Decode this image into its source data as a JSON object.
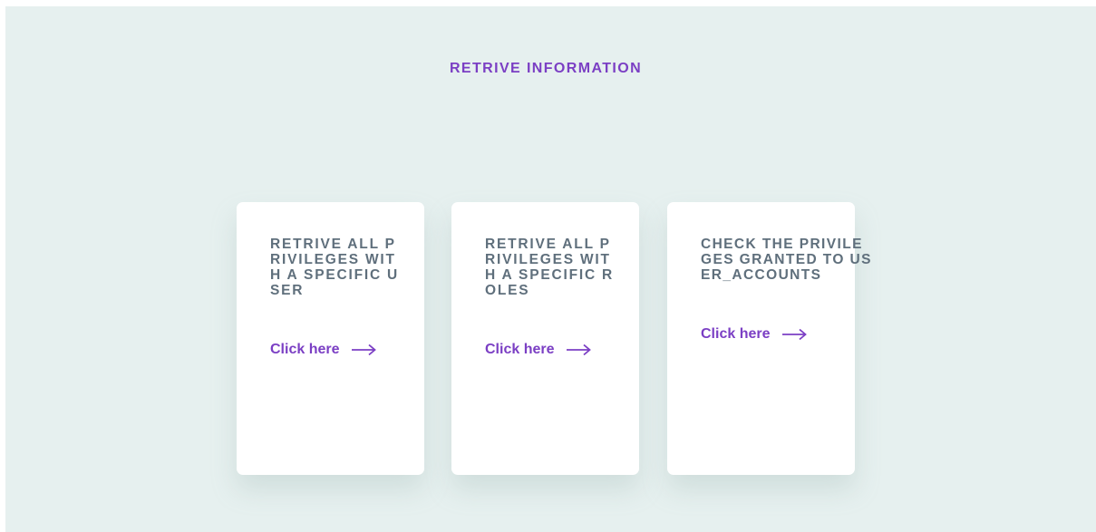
{
  "page": {
    "title": "RETRIVE INFORMATION"
  },
  "cards": [
    {
      "heading": "RETRIVE ALL PRIVILEGES WITH A SPECIFIC USER",
      "link_label": "Click here",
      "link_icon": "arrow-right-icon"
    },
    {
      "heading": "RETRIVE ALL PRIVILEGES WITH A SPECIFIC ROLES",
      "link_label": "Click here",
      "link_icon": "arrow-right-icon"
    },
    {
      "heading": "CHECK THE PRIVILEGES GRANTED TO USER_ACCOUNTS",
      "link_label": "Click here",
      "link_icon": "arrow-right-icon"
    }
  ],
  "colors": {
    "background": "#e6f0ef",
    "accent": "#7b3fc4",
    "heading_text": "#5f6f7c",
    "card": "#ffffff"
  }
}
